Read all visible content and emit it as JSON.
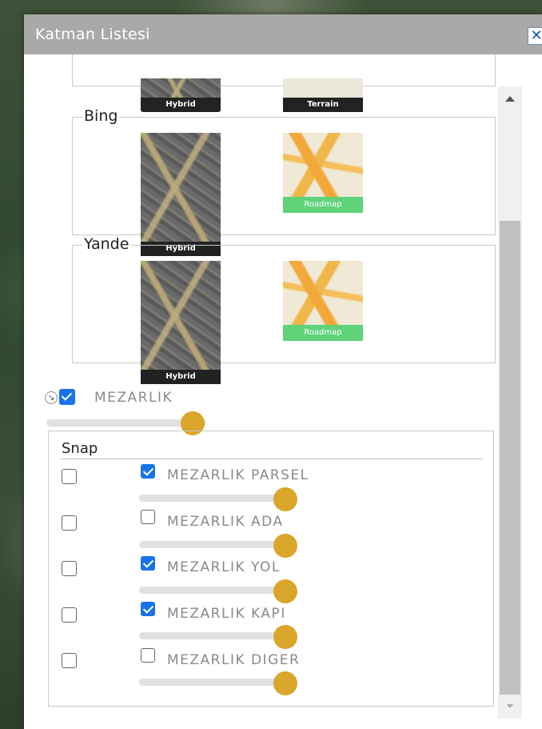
{
  "dialog": {
    "title": "Katman Listesi",
    "close_glyph": "✕"
  },
  "basemaps": {
    "google": {
      "thumbs": [
        {
          "label": "Hybrid",
          "style": "satellite"
        },
        {
          "label": "Terrain",
          "style": "terrain"
        }
      ]
    },
    "bing": {
      "legend": "Bing",
      "thumbs": [
        {
          "label": "Hybrid",
          "style": "satellite"
        },
        {
          "label": "Roadmap",
          "style": "roadmap"
        }
      ]
    },
    "yandex": {
      "legend": "Yande",
      "thumbs": [
        {
          "label": "Hybrid",
          "style": "satellite"
        },
        {
          "label": "Roadmap",
          "style": "roadmap"
        }
      ]
    }
  },
  "layer_group": {
    "name": "MEZARLIK",
    "checked": true,
    "opacity": 0.72,
    "expand_icon": "expand-arrow-icon"
  },
  "snap_panel": {
    "title": "Snap",
    "layers": [
      {
        "name": "MEZARLIK PARSEL",
        "visible": true,
        "snap": false,
        "opacity": 1.0
      },
      {
        "name": "MEZARLIK ADA",
        "visible": false,
        "snap": false,
        "opacity": 1.0
      },
      {
        "name": "MEZARLIK YOL",
        "visible": true,
        "snap": false,
        "opacity": 1.0
      },
      {
        "name": "MEZARLIK KAPI",
        "visible": true,
        "snap": false,
        "opacity": 1.0
      },
      {
        "name": "MEZARLIK DIGER",
        "visible": false,
        "snap": false,
        "opacity": 1.0
      }
    ]
  },
  "colors": {
    "titlebar": "#a9a9a9",
    "checkbox_checked": "#1a73e8",
    "slider_knob": "#daa52b",
    "roadmap_label": "#5fd27a"
  }
}
